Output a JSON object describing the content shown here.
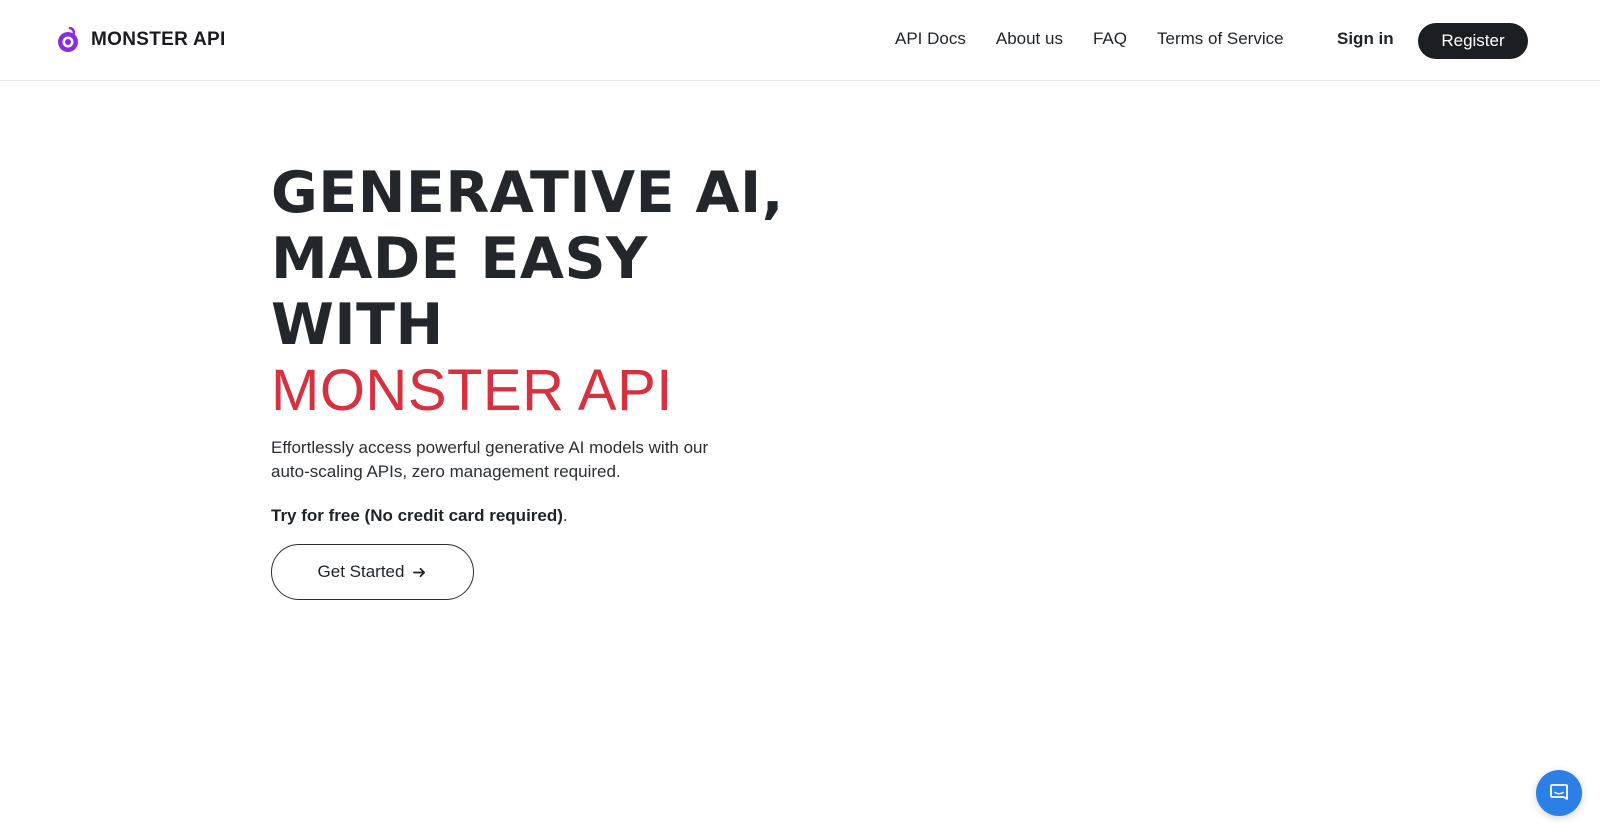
{
  "header": {
    "logo": {
      "text": "MONSTER API",
      "icon": "monster-eye-icon",
      "icon_color": "#8a2be2"
    },
    "nav": [
      {
        "label": "API Docs"
      },
      {
        "label": "About us"
      },
      {
        "label": "FAQ"
      },
      {
        "label": "Terms of Service"
      }
    ],
    "sign_in_label": "Sign in",
    "register_label": "Register"
  },
  "hero": {
    "title_lines": [
      "GENERATIVE AI,",
      "MADE EASY",
      "WITH"
    ],
    "brand": "MONSTER API",
    "description": "Effortlessly access powerful generative AI models with our auto-scaling APIs, zero management required.",
    "free_strong": "Try for free (No credit card required)",
    "free_suffix": ".",
    "cta_label": "Get Started",
    "cta_icon": "arrow-right-icon"
  },
  "chat_launcher": {
    "icon": "chat-bubble-icon",
    "color": "#2d7fe8"
  },
  "colors": {
    "accent_red": "#d6313f",
    "dark": "#1b1e22",
    "text": "#1f2328",
    "logo_purple": "#8a2be2"
  }
}
